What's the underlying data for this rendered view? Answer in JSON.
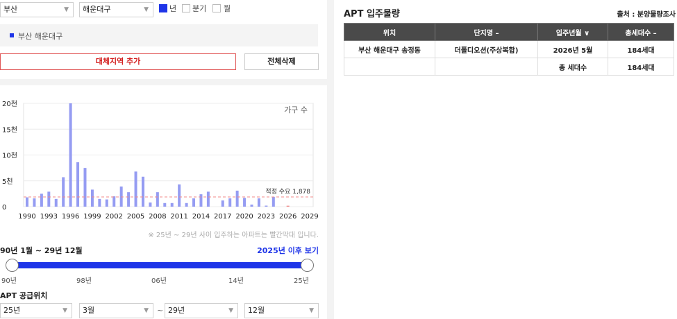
{
  "filters": {
    "city": "부산",
    "district": "해운대구",
    "period_options": [
      {
        "label": "년",
        "checked": true
      },
      {
        "label": "분기",
        "checked": false
      },
      {
        "label": "월",
        "checked": false
      }
    ]
  },
  "region": {
    "selected": "부산 해운대구"
  },
  "buttons": {
    "add_region": "대체지역 추가",
    "delete_all": "전체삭제"
  },
  "chart_data": {
    "type": "bar",
    "legend": "가구 수",
    "ylim": [
      0,
      20000
    ],
    "yticks": [
      {
        "value": 0,
        "label": "0"
      },
      {
        "value": 5000,
        "label": "5천"
      },
      {
        "value": 10000,
        "label": "10천"
      },
      {
        "value": 15000,
        "label": "15천"
      },
      {
        "value": 20000,
        "label": "20천"
      }
    ],
    "xticks": [
      "1990",
      "1993",
      "1996",
      "1999",
      "2002",
      "2005",
      "2008",
      "2011",
      "2014",
      "2017",
      "2020",
      "2023",
      "2026",
      "2029"
    ],
    "x": [
      1990,
      1991,
      1992,
      1993,
      1994,
      1995,
      1996,
      1997,
      1998,
      1999,
      2000,
      2001,
      2002,
      2003,
      2004,
      2005,
      2006,
      2007,
      2008,
      2009,
      2010,
      2011,
      2012,
      2013,
      2014,
      2015,
      2016,
      2017,
      2018,
      2019,
      2020,
      2021,
      2022,
      2023,
      2024,
      2025,
      2026,
      2027,
      2028,
      2029
    ],
    "values": [
      1800,
      1600,
      2500,
      2900,
      1500,
      5700,
      20000,
      8600,
      7500,
      3300,
      1500,
      1400,
      2000,
      3900,
      2800,
      6800,
      5800,
      800,
      2800,
      700,
      700,
      4300,
      700,
      1600,
      2400,
      2900,
      0,
      1200,
      1600,
      3100,
      1700,
      400,
      1600,
      200,
      1900,
      0,
      184,
      0,
      0,
      0
    ],
    "highlight_from": 2025,
    "base_color": "#959cf2",
    "highlight_color": "#f08a8a",
    "reference": {
      "label": "적정 수요 1,878",
      "value": 1878,
      "color": "#f08a8a"
    }
  },
  "chart_note": "※ 25년 ~ 29년 사이 입주하는 아파트는 빨간막대 입니다.",
  "period": {
    "range": "90년 1월 ~ 29년 12월",
    "link": "2025년 이후 보기"
  },
  "slider": {
    "ticks": [
      "90년",
      "98년",
      "06년",
      "14년",
      "25년"
    ],
    "range": [
      0,
      1
    ]
  },
  "supply": {
    "title": "APT 공급위치",
    "from_year": "25년",
    "from_month": "3월",
    "tilde": "~",
    "to_year": "29년",
    "to_month": "12월"
  },
  "right": {
    "title": "APT 입주물량",
    "source": "출처 : 분양물량조사",
    "columns": [
      "위치",
      "단지명 –",
      "입주년월 ∨",
      "총세대수 –"
    ],
    "rows": [
      [
        "부산 해운대구 송정동",
        "더폴디오션(주상복합)",
        "2026년 5월",
        "184세대"
      ],
      [
        "",
        "",
        "총 세대수",
        "184세대"
      ]
    ]
  }
}
